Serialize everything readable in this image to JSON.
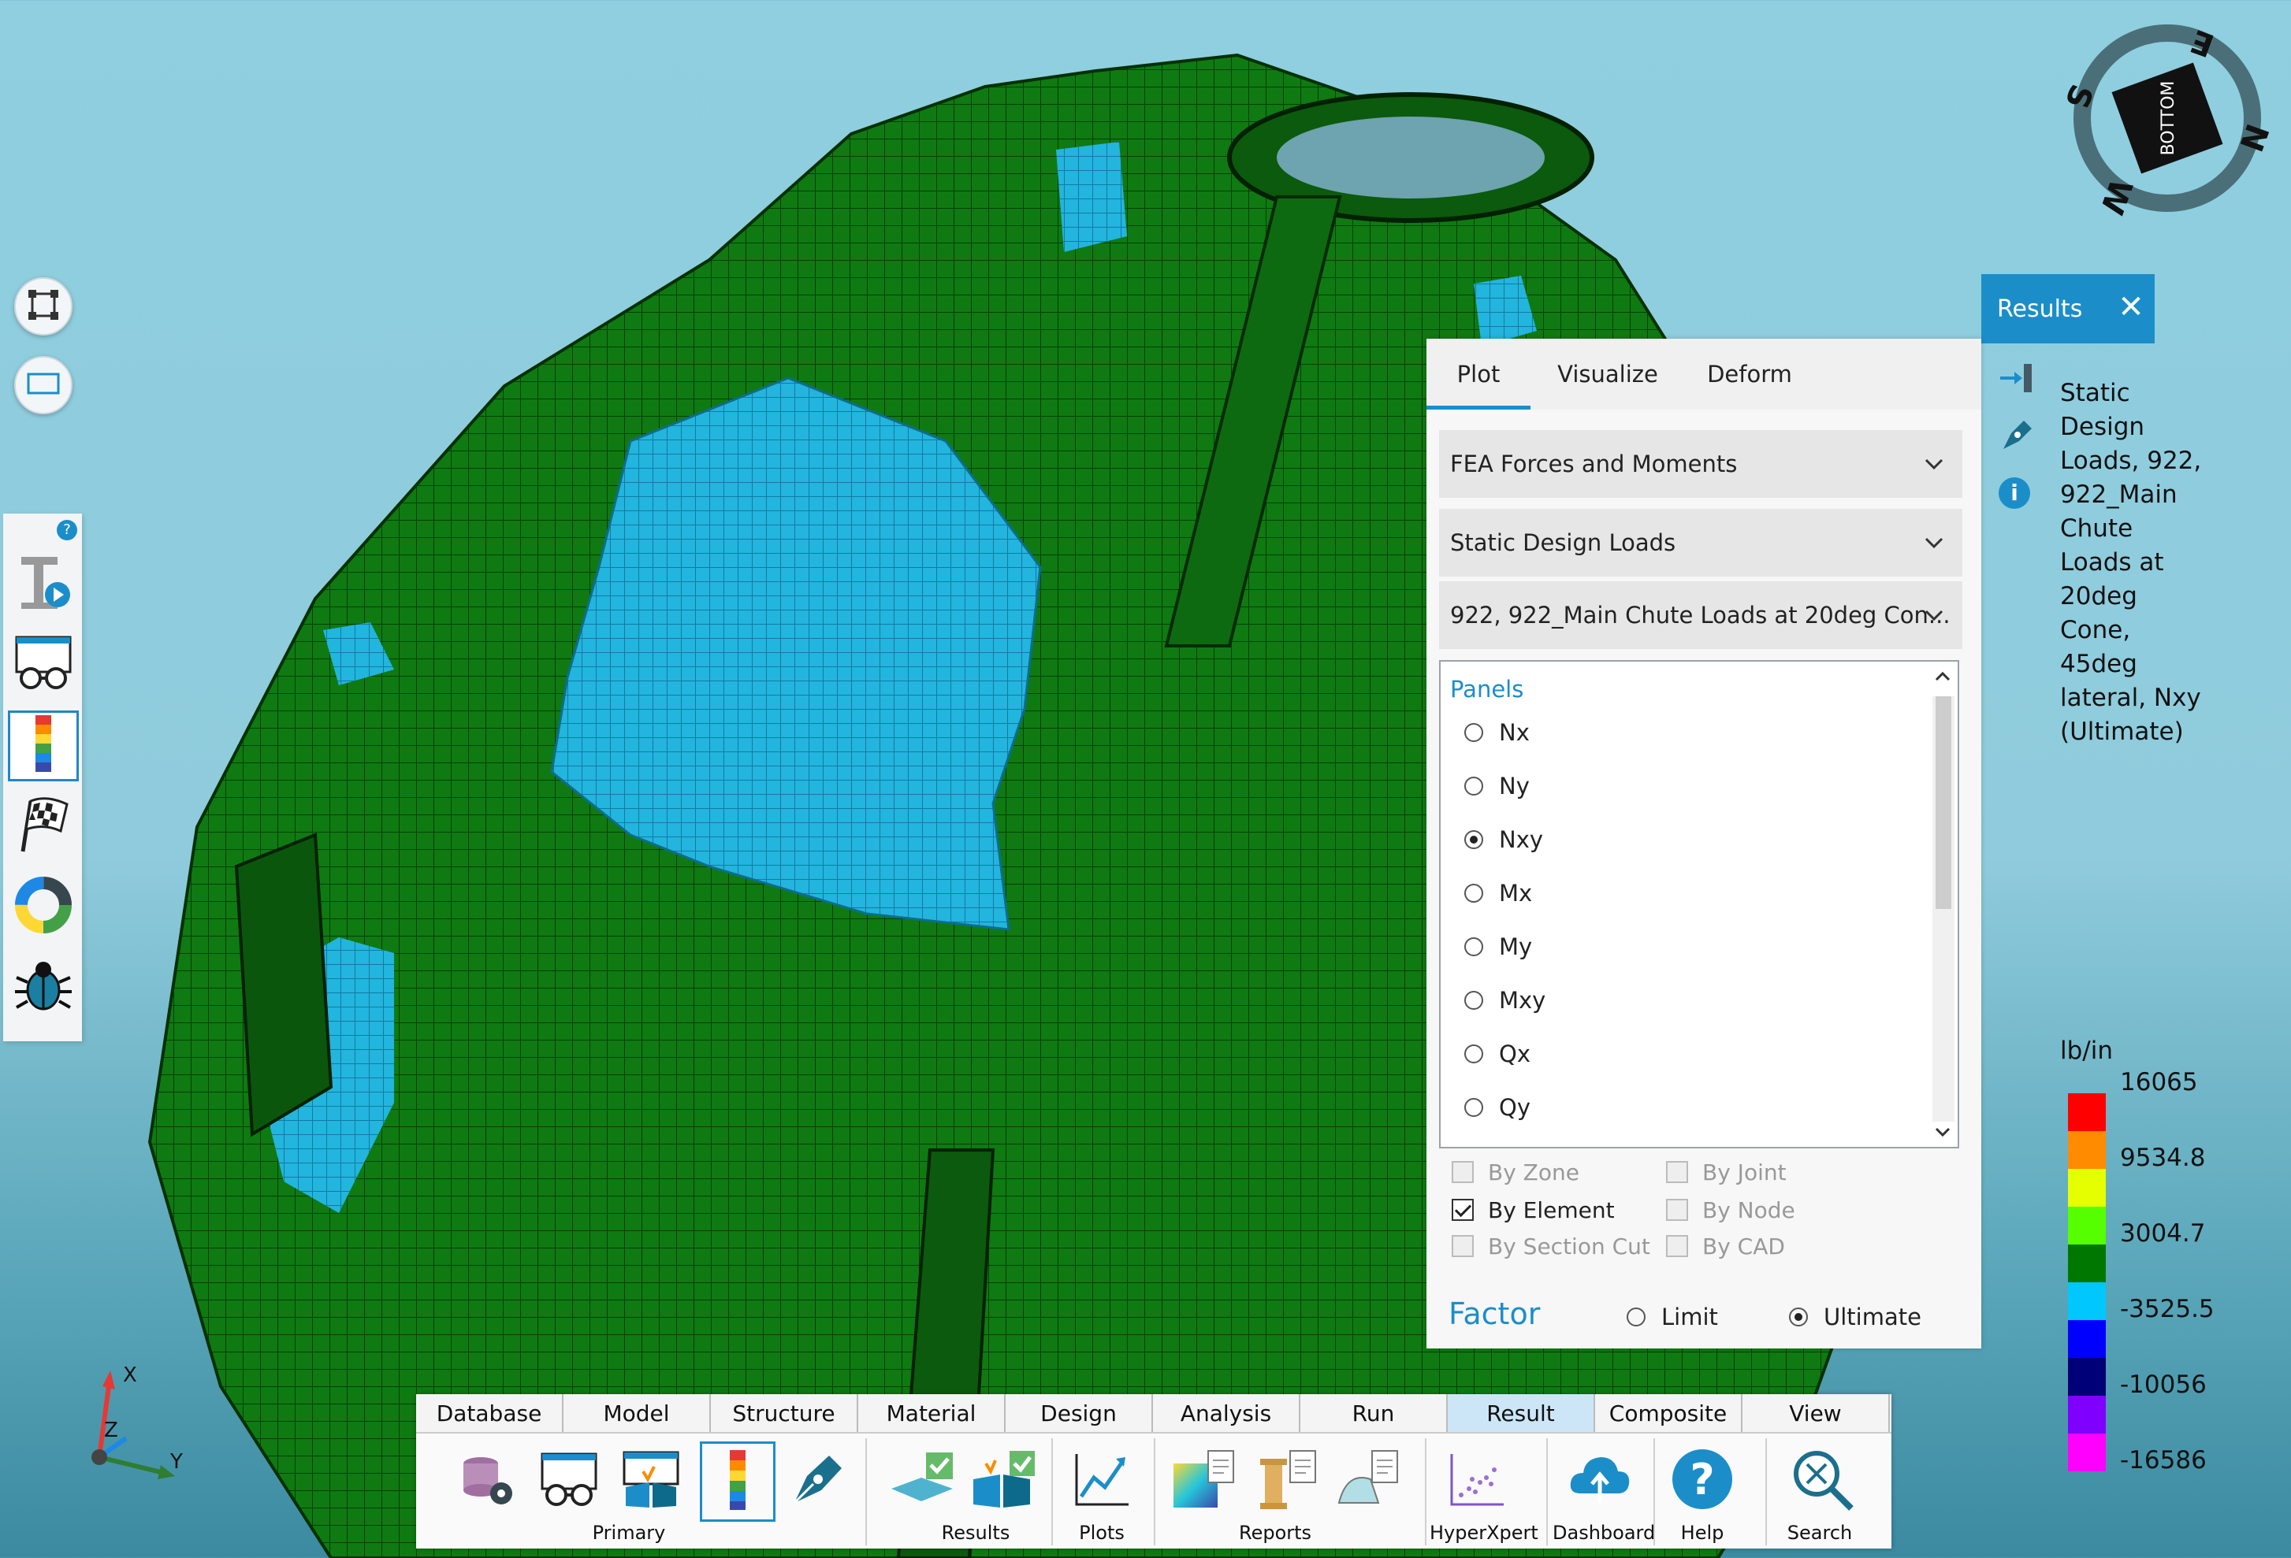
{
  "results_panel": {
    "title": "Results",
    "description": "Static Design Loads, 922, 922_Main Chute Loads at 20deg Cone, 45deg lateral, Nxy (Ultimate)",
    "desc_lines": [
      "Static",
      "Design",
      "Loads, 922,",
      "922_Main",
      "Chute",
      "Loads at",
      "20deg",
      "Cone,",
      "45deg",
      "lateral, Nxy",
      "(Ultimate)"
    ],
    "unit": "lb/in",
    "legend_values": [
      "16065",
      "9534.8",
      "3004.7",
      "-3525.5",
      "-10056",
      "-16586"
    ],
    "legend_colors": [
      "#ff0000",
      "#ff8c00",
      "#e5ff00",
      "#55ff00",
      "#007800",
      "#00c8ff",
      "#0000ff",
      "#000078",
      "#7f00ff",
      "#ff00ff"
    ]
  },
  "plot_panel": {
    "tabs": [
      "Plot",
      "Visualize",
      "Deform"
    ],
    "active_tab": "Plot",
    "dropdowns": [
      "FEA Forces and Moments",
      "Static Design Loads",
      "922, 922_Main Chute Loads at 20deg Con..."
    ],
    "panels_title": "Panels",
    "radio_options": [
      "Nx",
      "Ny",
      "Nxy",
      "Mx",
      "My",
      "Mxy",
      "Qx",
      "Qy"
    ],
    "selected_radio": "Nxy",
    "checkboxes": [
      {
        "label": "By Zone",
        "checked": false,
        "enabled": false
      },
      {
        "label": "By Joint",
        "checked": false,
        "enabled": false
      },
      {
        "label": "By Element",
        "checked": true,
        "enabled": true
      },
      {
        "label": "By Node",
        "checked": false,
        "enabled": false
      },
      {
        "label": "By Section Cut",
        "checked": false,
        "enabled": false
      },
      {
        "label": "By CAD",
        "checked": false,
        "enabled": false
      }
    ],
    "factor_label": "Factor",
    "factor_options": [
      "Limit",
      "Ultimate"
    ],
    "factor_selected": "Ultimate"
  },
  "ribbon": {
    "tabs": [
      "Database",
      "Model",
      "Structure",
      "Material",
      "Design",
      "Analysis",
      "Run",
      "Result",
      "Composite",
      "View"
    ],
    "active_tab": "Result",
    "groups": [
      "Primary",
      "Results",
      "Plots",
      "Reports",
      "HyperXpert",
      "Dashboard",
      "Help",
      "Search"
    ]
  },
  "compass": {
    "labels": [
      "E",
      "N",
      "W",
      "S"
    ],
    "face": "BOTTOM"
  },
  "axis_triad": {
    "labels": [
      "X",
      "Y",
      "Z"
    ]
  },
  "left_toolbar": {
    "help_badge": "?"
  }
}
